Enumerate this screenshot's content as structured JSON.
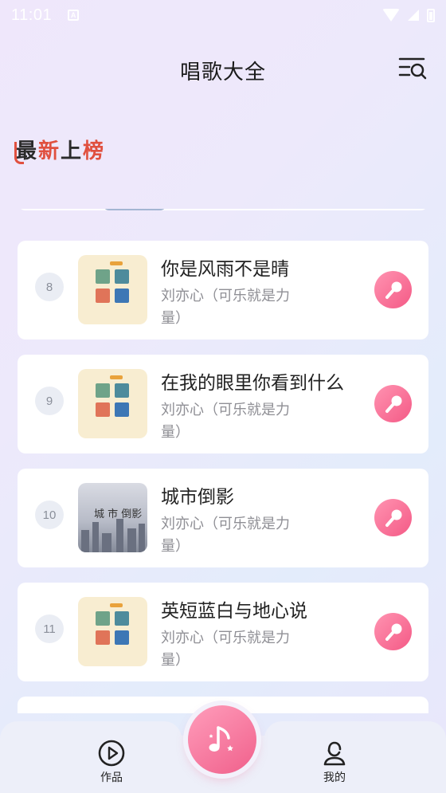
{
  "status_bar": {
    "time": "11:01",
    "notification_icon": "A"
  },
  "header": {
    "title": "唱歌大全",
    "search_icon": "search-list-icon"
  },
  "section": {
    "banner_part1": "最",
    "banner_part2": "新",
    "banner_part3": "上",
    "banner_part4": "榜"
  },
  "songs": [
    {
      "rank": "8",
      "title": "你是风雨不是晴",
      "artist": "刘亦心（可乐就是力量）"
    },
    {
      "rank": "9",
      "title": "在我的眼里你看到什么",
      "artist": "刘亦心（可乐就是力量）"
    },
    {
      "rank": "10",
      "title": "城市倒影",
      "artist": "刘亦心（可乐就是力量）",
      "cover_text": "城 市 倒影"
    },
    {
      "rank": "11",
      "title": "英短蓝白与地心说",
      "artist": "刘亦心（可乐就是力量）"
    }
  ],
  "tab_bar": {
    "works_label": "作品",
    "mine_label": "我的",
    "center_icon": "music-note-icon"
  },
  "colors": {
    "accent": "#f45a86",
    "card": "#ffffff",
    "rank_bg": "#eaedf4"
  }
}
